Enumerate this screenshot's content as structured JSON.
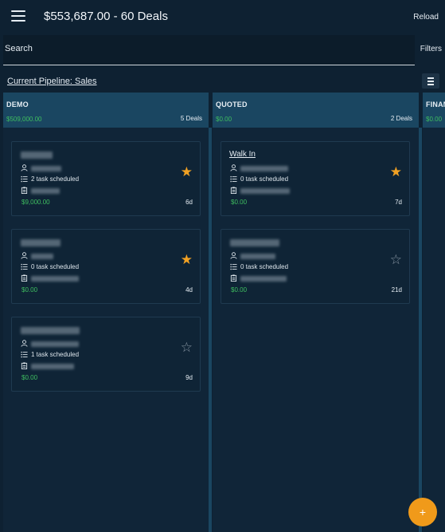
{
  "header": {
    "title": "$553,687.00 - 60 Deals",
    "reload_label": "Reload"
  },
  "search": {
    "placeholder": "Search",
    "filters_label": "Filters"
  },
  "pipeline": {
    "label": "Current Pipeline: Sales"
  },
  "columns": [
    {
      "name": "DEMO",
      "amount": "$509,000.00",
      "count": "5 Deals",
      "cards": [
        {
          "title": "",
          "tasks": "2 task scheduled",
          "amount": "$9,000.00",
          "age": "6d",
          "starred": true
        },
        {
          "title": "",
          "tasks": "0 task scheduled",
          "amount": "$0.00",
          "age": "4d",
          "starred": true
        },
        {
          "title": "",
          "tasks": "1 task scheduled",
          "amount": "$0.00",
          "age": "9d",
          "starred": false
        }
      ]
    },
    {
      "name": "QUOTED",
      "amount": "$0.00",
      "count": "2 Deals",
      "cards": [
        {
          "title": "Walk In",
          "tasks": "0 task scheduled",
          "amount": "$0.00",
          "age": "7d",
          "starred": true
        },
        {
          "title": "",
          "tasks": "0 task scheduled",
          "amount": "$0.00",
          "age": "21d",
          "starred": false
        }
      ]
    },
    {
      "name": "FINAN",
      "amount": "$0.00"
    }
  ],
  "icons": {
    "star_filled": "★",
    "star_empty": "☆",
    "fab": "+"
  },
  "colors": {
    "accent": "#f09a1a",
    "money": "#3fbf60",
    "column_header": "#1a4661",
    "background": "#0e2132"
  }
}
